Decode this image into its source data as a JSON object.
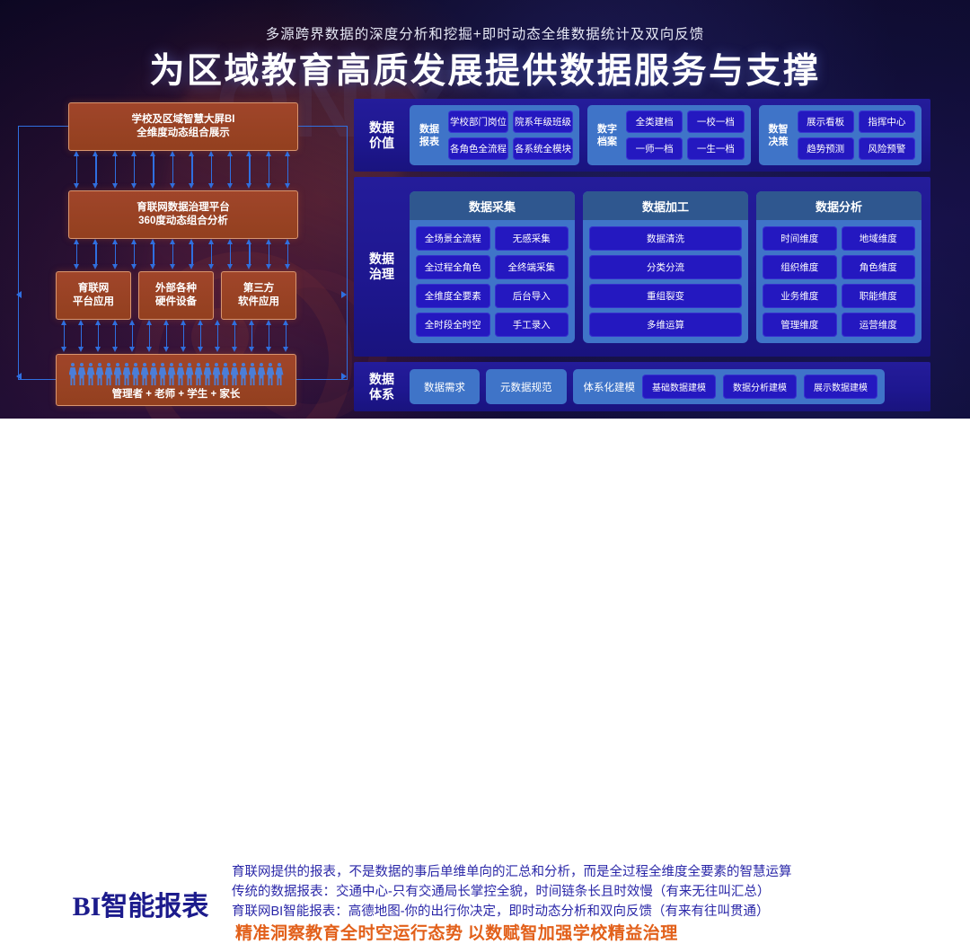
{
  "header": {
    "subtitle": "多源跨界数据的深度分析和挖掘+即时动态全维数据统计及双向反馈",
    "title": "为区域教育高质发展提供数据服务与支撑",
    "watermark": "ONIX"
  },
  "colors": {
    "hero_bg": "#0d0a28",
    "flow_box": "#a0452a",
    "arrow": "#2f6fe0",
    "band_bg": "#241c9a",
    "group_bg": "#3f74c8",
    "pill_bg": "#2418c0",
    "col_head": "#2f578f",
    "foot_title": "#1c1b8c",
    "foot_text": "#2a27a8",
    "foot_tag": "#e2601a"
  },
  "flow": {
    "boxes": [
      {
        "line1": "学校及区域智慧大屏BI",
        "line2": "全维度动态组合展示"
      },
      {
        "line1": "育联网数据治理平台",
        "line2": "360度动态组合分析"
      },
      {
        "line1": "育联网",
        "line2": "平台应用"
      },
      {
        "line1": "外部各种",
        "line2": "硬件设备"
      },
      {
        "line1": "第三方",
        "line2": "软件应用"
      }
    ],
    "users_label": "管理者 + 老师 + 学生 + 家长",
    "people_count": 24
  },
  "rows": [
    {
      "label_1": "数据",
      "label_2": "价值",
      "groups": [
        {
          "name_1": "数据",
          "name_2": "报表",
          "items": [
            "学校部门岗位",
            "院系年级班级",
            "各角色全流程",
            "各系统全模块"
          ]
        },
        {
          "name_1": "数字",
          "name_2": "档案",
          "items": [
            "全类建档",
            "一校一档",
            "一师一档",
            "一生一档"
          ]
        },
        {
          "name_1": "数智",
          "name_2": "决策",
          "items": [
            "展示看板",
            "指挥中心",
            "趋势预测",
            "风险预警"
          ]
        }
      ]
    }
  ],
  "governance": {
    "label_1": "数据",
    "label_2": "治理",
    "columns": [
      {
        "head": "数据采集",
        "cols": 2,
        "items": [
          "全场景全流程",
          "无感采集",
          "全过程全角色",
          "全终端采集",
          "全维度全要素",
          "后台导入",
          "全时段全时空",
          "手工录入"
        ]
      },
      {
        "head": "数据加工",
        "cols": 1,
        "items": [
          "数据清洗",
          "分类分流",
          "重组裂变",
          "多维运算"
        ]
      },
      {
        "head": "数据分析",
        "cols": 2,
        "items": [
          "时间维度",
          "地域维度",
          "组织维度",
          "角色维度",
          "业务维度",
          "职能维度",
          "管理维度",
          "运营维度"
        ]
      }
    ]
  },
  "system": {
    "label_1": "数据",
    "label_2": "体系",
    "chips": [
      "数据需求",
      "元数据规范"
    ],
    "modeling": {
      "name": "体系化建模",
      "subs": [
        "基础数据建模",
        "数据分析建模",
        "展示数据建模"
      ]
    }
  },
  "footer": {
    "title": "BI智能报表",
    "lines": [
      "育联网提供的报表，不是数据的事后单维单向的汇总和分析，而是全过程全维度全要素的智慧运算",
      "传统的数据报表：交通中心-只有交通局长掌控全貌，时间链条长且时效慢（有来无往叫汇总）",
      "育联网BI智能报表：高德地图-你的出行你决定，即时动态分析和双向反馈（有来有往叫贯通）"
    ],
    "tagline": "精准洞察教育全时空运行态势 以数赋智加强学校精益治理"
  }
}
